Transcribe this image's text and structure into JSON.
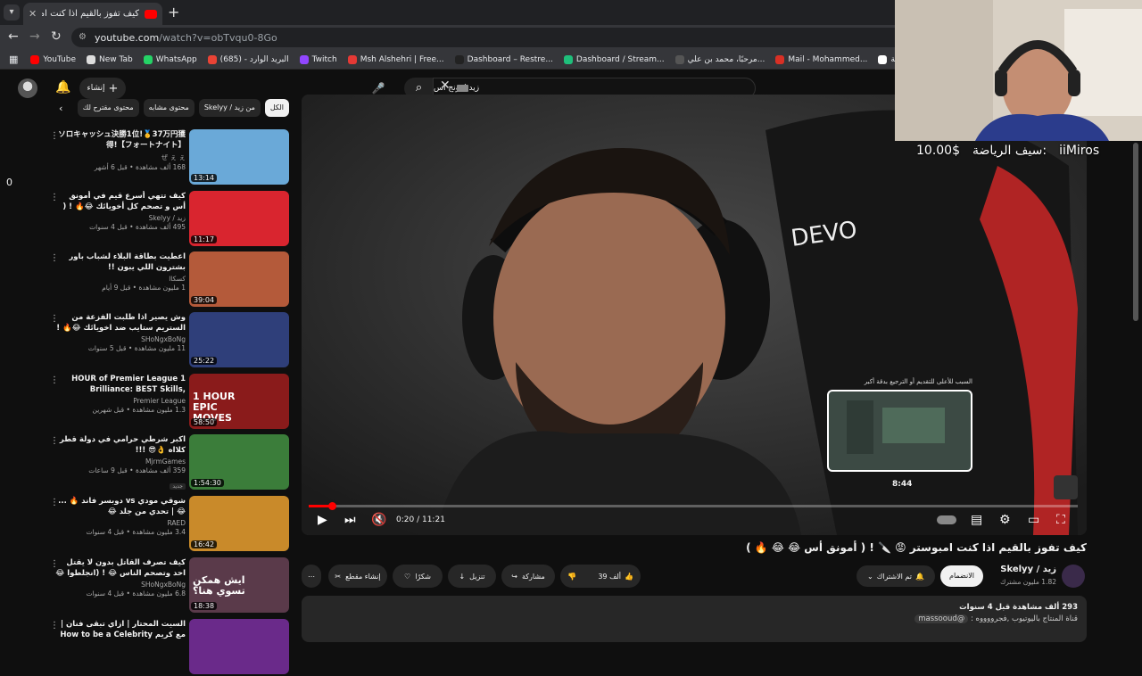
{
  "browser": {
    "tab_title": "كيف تفوز بالقيم اذا كنت امبوستر",
    "new_tab_symbol": "+",
    "url_host": "youtube.com",
    "url_path": "/watch?v=obTvqu0-8Go",
    "bookmarks": [
      {
        "label": "YouTube",
        "color": "#ff0000"
      },
      {
        "label": "New Tab",
        "color": "#dddddd"
      },
      {
        "label": "WhatsApp",
        "color": "#25d366"
      },
      {
        "label": "البريد الوارد - (685)",
        "color": "#ea4335"
      },
      {
        "label": "Twitch",
        "color": "#9146ff"
      },
      {
        "label": "Msh Alshehri | Free...",
        "color": "#e53935"
      },
      {
        "label": "Dashboard – Restre...",
        "color": "#222222"
      },
      {
        "label": "Dashboard / Stream...",
        "color": "#1fbf7b"
      },
      {
        "label": "مرحبًا، محمد بن علي...",
        "color": "#555555"
      },
      {
        "label": "Mail - Mohammed...",
        "color": "#d93025"
      },
      {
        "label": "القائمة الرئيسية",
        "color": "#ffffff"
      }
    ]
  },
  "header": {
    "create_label": "إنشاء",
    "search_value": "زيد امونج اس"
  },
  "chips": [
    "الكل",
    "من زيد / Skelyy",
    "محتوى مشابه",
    "محتوى مقترح لك"
  ],
  "sidebar_items": [
    {
      "title": "ソロキャッシュ決勝1位!🥇37万円獲得!【フォートナイト】",
      "channel": "ぜ ぇ ぇ",
      "stats": "168 ألف مشاهدة • قبل 6 أشهر",
      "duration": "13:14",
      "thumb_color": "#6aa9d8"
    },
    {
      "title": "كيف تتهي أسرع قيم في أمونق أس و تصحم كل أخويائك 😂🔥 ! ( مع شوقي 😡 !)",
      "channel": "زيد / Skelyy",
      "stats": "495 ألف مشاهدة • قبل 4 سنوات",
      "duration": "11:17",
      "thumb_color": "#d9252f"
    },
    {
      "title": "اعطيت بطاقة البلاء لشباب باور بشترون اللي يبون !!",
      "channel": "كسكاا",
      "stats": "1 مليون مشاهدة • قبل 9 أيام",
      "duration": "39:04",
      "thumb_color": "#b45a3a"
    },
    {
      "title": "وش يصير اذا طلبت الفزعة من الستريم ستايب ضد اخويائك 😂🔥 ! (سكواد المجا...",
      "channel": "SHoNgxBoNg",
      "stats": "11 مليون مشاهدة • قبل 5 سنوات",
      "duration": "25:22",
      "thumb_color": "#2f3f7a"
    },
    {
      "title": "1 HOUR of Premier League Brilliance: BEST Skills, Dribbles...",
      "channel": "Premier League",
      "stats": "1.3 مليون مشاهدة • قبل شهرين",
      "duration": "58:50",
      "thumb_color": "#8a1b1b",
      "thumb_text": "1 HOUR EPIC MOVES"
    },
    {
      "title": "اكبر شرطي حرامي في دولة قطر كلااه 👌😎 !!!",
      "channel": "MjrmGames",
      "stats": "359 ألف مشاهدة • قبل 9 ساعات",
      "duration": "1:54:30",
      "thumb_color": "#3b7d3a",
      "badge": "جديد"
    },
    {
      "title": "شوقي مودي vs دوبسر فاند 🔥 ... 😂 | تحدي من جلد 😂",
      "channel": "RAED",
      "stats": "3.4 مليون مشاهدة • قبل 4 سنوات",
      "duration": "16:42",
      "thumb_color": "#c98a2a"
    },
    {
      "title": "كيف تصرف القاتل بدون لا يقتل احد وتصحم الناس 😂 ! (انجلطوا 😂🔥)",
      "channel": "SHoNgxBoNg",
      "stats": "6.8 مليون مشاهدة • قبل 4 سنوات",
      "duration": "18:38",
      "thumb_color": "#5a3a4a",
      "thumb_text": "ايش همكن تسوي هنا؟"
    },
    {
      "title": "السيت المحتار | ازاي تبقى فنان | مع كريم How to be a Celebrity | كابي...",
      "channel": "",
      "stats": "",
      "duration": "",
      "thumb_color": "#6a2a8a"
    }
  ],
  "player": {
    "time_current": "0:20",
    "time_total": "11:21",
    "progress_fraction": 0.03,
    "preview_time": "8:44",
    "preview_title": "السبب للأعلى للتقديم أو الترجيع بدقة أكبر"
  },
  "video": {
    "title": "كيف تفوز بالقيم اذا كنت امبوستر 😡 🔪 ! ( أمونق أس 😂 😂 🔥 )",
    "channel_name": "زيد / Skelyy",
    "subscribers": "1.82 مليون مشترك",
    "join_label": "الانضمام",
    "subscribed_label": "تم الاشتراك",
    "likes": "39 ألف",
    "share_label": "مشاركة",
    "download_label": "تنزيل",
    "thanks_label": "شكرًا",
    "clip_label": "إنشاء مقطع",
    "desc_stats": "293 ألف مشاهدة  قبل 4 سنوات",
    "desc_line": "قناة المنتاج باليوتيوب ,فجرووووه :",
    "desc_handle": "@massooud"
  },
  "overlay": {
    "donation_user": "iiMiros",
    "donation_text": "سيف الرياضة:",
    "donation_amount": "10.00$",
    "left_counter": "0"
  }
}
